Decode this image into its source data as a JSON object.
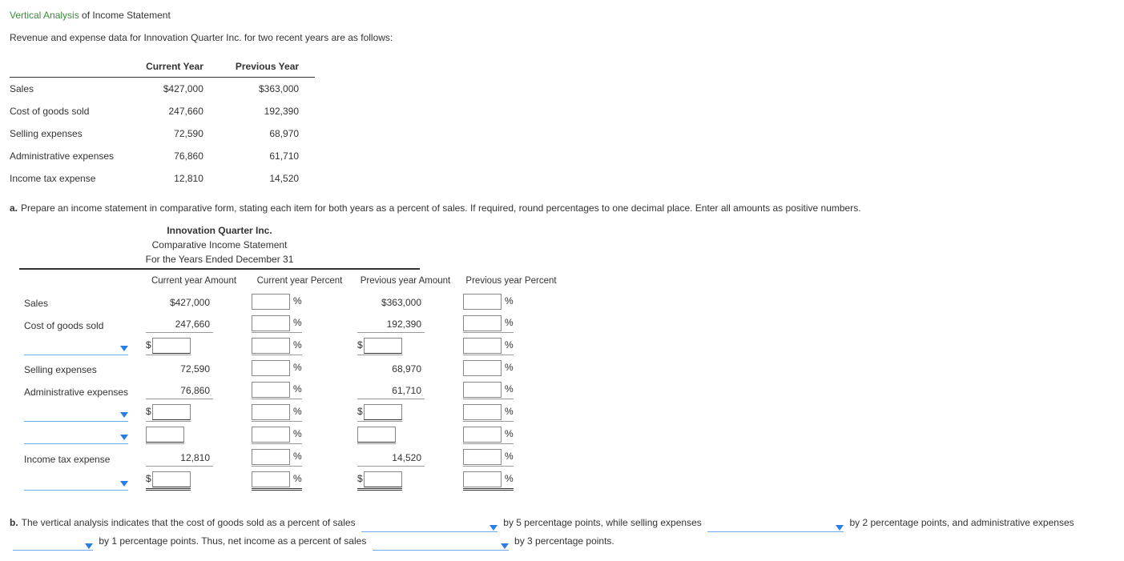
{
  "title": {
    "green": "Vertical Analysis",
    "rest": " of Income Statement"
  },
  "intro": "Revenue and expense data for Innovation Quarter Inc. for two recent years are as follows:",
  "data_table": {
    "headers": [
      "",
      "Current Year",
      "Previous Year"
    ],
    "rows": [
      {
        "label": "Sales",
        "cy": "$427,000",
        "py": "$363,000"
      },
      {
        "label": "Cost of goods sold",
        "cy": "247,660",
        "py": "192,390"
      },
      {
        "label": "Selling expenses",
        "cy": "72,590",
        "py": "68,970"
      },
      {
        "label": "Administrative expenses",
        "cy": "76,860",
        "py": "61,710"
      },
      {
        "label": "Income tax expense",
        "cy": "12,810",
        "py": "14,520"
      }
    ]
  },
  "part_a": {
    "marker": "a.",
    "text": "Prepare an income statement in comparative form, stating each item for both years as a percent of sales. If required, round percentages to one decimal place. Enter all amounts as positive numbers."
  },
  "statement": {
    "company": "Innovation Quarter Inc.",
    "title": "Comparative Income Statement",
    "period": "For the Years Ended December 31",
    "col_headers": [
      "Current year Amount",
      "Current year Percent",
      "Previous year Amount",
      "Previous year Percent"
    ],
    "pct_sign": "%",
    "dollar": "$",
    "rows": {
      "sales": {
        "label": "Sales",
        "cy_amt": "$427,000",
        "py_amt": "$363,000"
      },
      "cogs": {
        "label": "Cost of goods sold",
        "cy_amt": "247,660",
        "py_amt": "192,390"
      },
      "selling": {
        "label": "Selling expenses",
        "cy_amt": "72,590",
        "py_amt": "68,970"
      },
      "admin": {
        "label": "Administrative expenses",
        "cy_amt": "76,860",
        "py_amt": "61,710"
      },
      "tax": {
        "label": "Income tax expense",
        "cy_amt": "12,810",
        "py_amt": "14,520"
      }
    }
  },
  "part_b": {
    "marker": "b.",
    "seg1": "The vertical analysis indicates that the cost of goods sold as a percent of sales",
    "seg2": "by 5 percentage points, while selling expenses",
    "seg3": "by 2 percentage points, and administrative expenses",
    "seg4": "by 1 percentage points. Thus, net income as a percent of sales",
    "seg5": "by 3 percentage points."
  }
}
